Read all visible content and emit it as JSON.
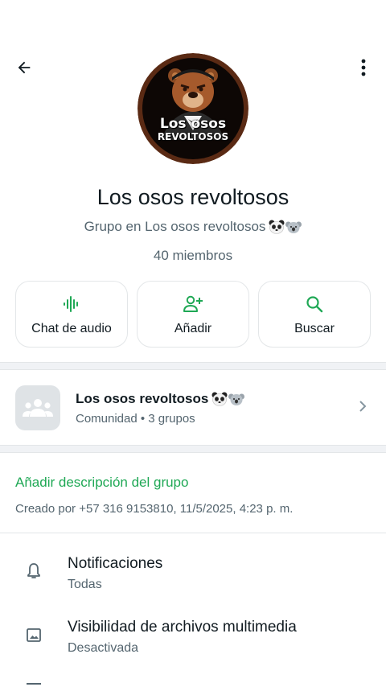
{
  "header": {
    "back_icon": "arrow-left-icon",
    "menu_icon": "more-vertical-icon"
  },
  "group": {
    "logo_text_line1": "Los osos",
    "logo_text_line2": "REVOLTOSOS",
    "name": "Los osos revoltosos",
    "subtitle": "Grupo en Los osos revoltosos",
    "members": "40 miembros"
  },
  "actions": [
    {
      "label": "Chat de audio",
      "icon": "audio-waveform-icon"
    },
    {
      "label": "Añadir",
      "icon": "add-person-icon"
    },
    {
      "label": "Buscar",
      "icon": "search-icon"
    }
  ],
  "community": {
    "name": "Los osos revoltosos",
    "subtitle": "Comunidad • 3 grupos",
    "icon": "community-group-icon"
  },
  "description": {
    "add_label": "Añadir descripción del grupo",
    "created_by": "Creado por +57 316 9153810, 11/5/2025, 4:23 p. m."
  },
  "settings": [
    {
      "title": "Notificaciones",
      "value": "Todas",
      "icon": "bell-icon"
    },
    {
      "title": "Visibilidad de archivos multimedia",
      "value": "Desactivada",
      "icon": "image-icon"
    }
  ],
  "colors": {
    "accent": "#1fa855",
    "text_primary": "#111b21",
    "text_secondary": "#54656f",
    "logo_ring": "#5a2a14"
  }
}
